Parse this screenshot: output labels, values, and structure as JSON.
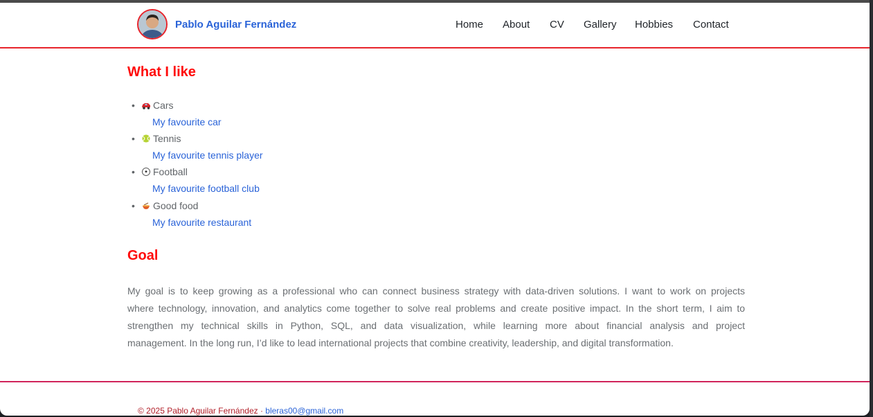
{
  "header": {
    "brand": "Pablo Aguilar Fernández",
    "nav": [
      "Home",
      "About",
      "CV",
      "Gallery",
      "Hobbies",
      "Contact"
    ]
  },
  "likes": {
    "heading": "What I like",
    "items": [
      {
        "icon": "car-icon",
        "label": "Cars",
        "link": "My favourite car"
      },
      {
        "icon": "tennis-ball-icon",
        "label": "Tennis",
        "link": "My favourite tennis player"
      },
      {
        "icon": "soccer-ball-icon",
        "label": "Football",
        "link": "My favourite football club"
      },
      {
        "icon": "food-bowl-icon",
        "label": "Good food",
        "link": "My favourite restaurant"
      }
    ]
  },
  "goal": {
    "heading": "Goal",
    "lines": [
      "My goal is to keep growing as a professional who can connect business strategy with data-driven solutions. I want to work on projects",
      "where technology, innovation, and analytics come together to solve real problems and create positive impact. In the short term, I aim to",
      "strengthen my technical skills in Python, SQL, and data visualization, while learning more about financial analysis and project",
      "management. In the long run, I’d like to lead international projects that combine creativity, leadership, and digital transformation."
    ]
  },
  "footer": {
    "copyright": "© 2025 Pablo Aguilar Fernández · ",
    "email": "bleras00@gmail.com"
  },
  "colors": {
    "accent_red": "#ff0a0a",
    "link_blue": "#2a63d8"
  }
}
